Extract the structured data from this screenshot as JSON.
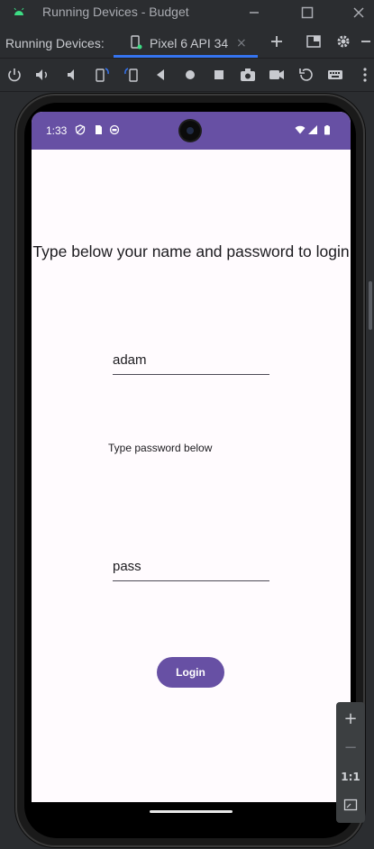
{
  "window": {
    "title": "Running Devices - Budget"
  },
  "tabbar": {
    "section_label": "Running Devices:",
    "tab_label": "Pixel 6 API 34",
    "tab_close": "×"
  },
  "device": {
    "status_time": "1:33",
    "title_text": "Type below your name and password to login",
    "name_value": "adam",
    "password_hint": "Type password below",
    "password_value": "pass",
    "login_label": "Login"
  },
  "zoom": {
    "plus": "+",
    "minus": "−",
    "one_to_one": "1:1"
  },
  "colors": {
    "accent": "#6750a4",
    "tab_underline": "#3574f0",
    "android_green": "#3ddc84"
  }
}
